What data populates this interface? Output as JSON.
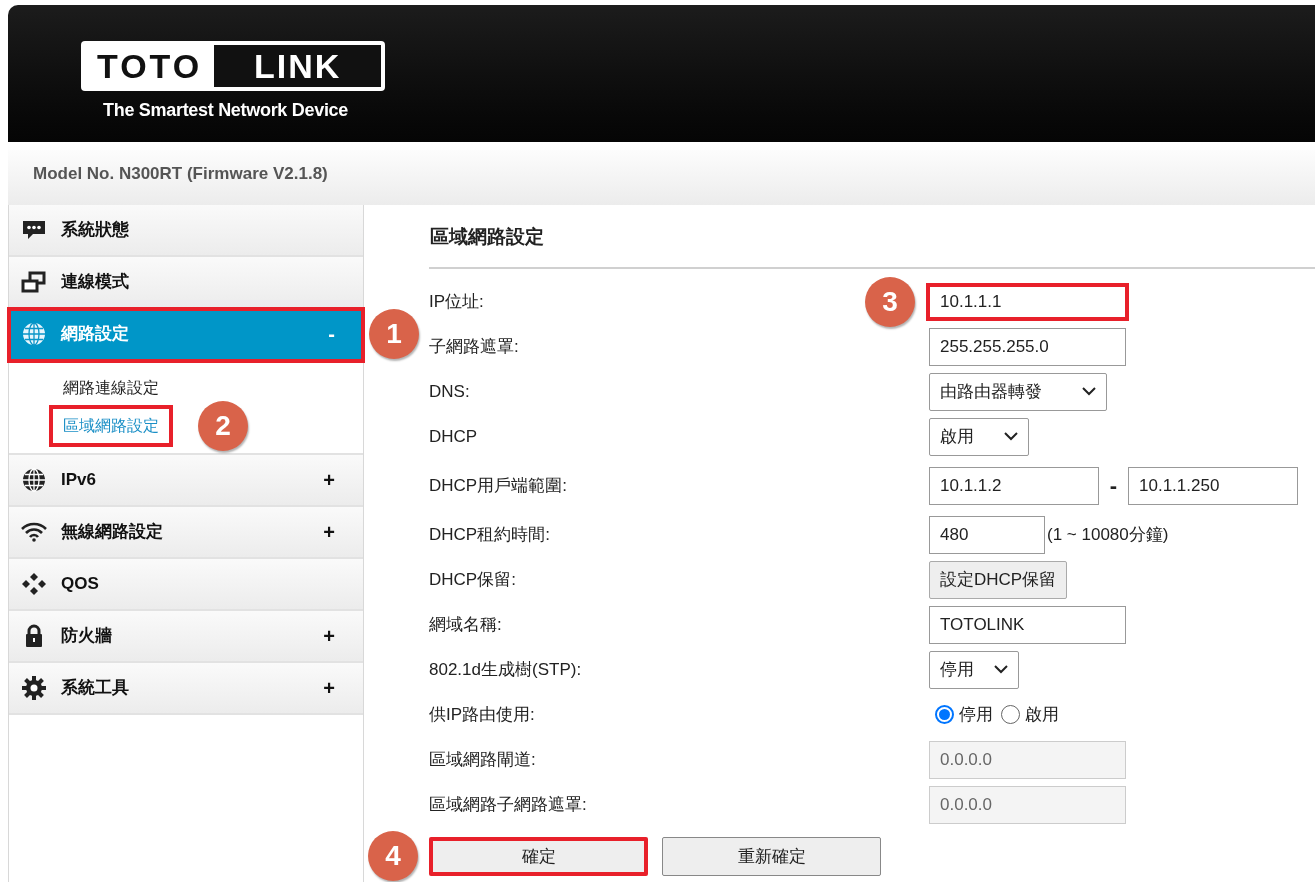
{
  "header": {
    "logo_left": "TOTO",
    "logo_right": "LINK",
    "tagline": "The Smartest Network Device"
  },
  "model_line": "Model No. N300RT (Firmware V2.1.8)",
  "sidebar": {
    "items": [
      {
        "label": "系統狀態",
        "selected": false
      },
      {
        "label": "連線模式",
        "selected": false
      },
      {
        "label": "網路設定",
        "selected": true,
        "toggle": "-",
        "expanded": true,
        "callout": "1",
        "children": [
          {
            "label": "網路連線設定",
            "selected": false
          },
          {
            "label": "區域網路設定",
            "selected": true,
            "callout": "2"
          }
        ]
      },
      {
        "label": "IPv6",
        "selected": false,
        "toggle": "+"
      },
      {
        "label": "無線網路設定",
        "selected": false,
        "toggle": "+"
      },
      {
        "label": "QOS",
        "selected": false
      },
      {
        "label": "防火牆",
        "selected": false,
        "toggle": "+"
      },
      {
        "label": "系統工具",
        "selected": false,
        "toggle": "+"
      }
    ]
  },
  "form": {
    "title": "區域網路設定",
    "rows": [
      {
        "kind": "text",
        "label": "IP位址:",
        "value": "10.1.1.1",
        "callout": "3"
      },
      {
        "kind": "text",
        "label": "子網路遮罩:",
        "value": "255.255.255.0"
      },
      {
        "kind": "select",
        "label": "DNS:",
        "value": "由路由器轉發"
      },
      {
        "kind": "select",
        "label": "DHCP",
        "value": "啟用"
      },
      {
        "kind": "range",
        "label": "DHCP用戶端範圍:",
        "from": "10.1.1.2",
        "separator": "-",
        "to": "10.1.1.250"
      },
      {
        "kind": "note",
        "label": "DHCP租約時間:",
        "value": "480",
        "note": "(1 ~ 10080分鐘)"
      },
      {
        "kind": "button",
        "label": "DHCP保留:",
        "button": "設定DHCP保留"
      },
      {
        "kind": "text",
        "label": "網域名稱:",
        "value": "TOTOLINK"
      },
      {
        "kind": "select",
        "label": "802.1d生成樹(STP):",
        "value": "停用"
      },
      {
        "kind": "radio",
        "label": "供IP路由使用:",
        "options": [
          {
            "label": "停用",
            "selected": true
          },
          {
            "label": "啟用",
            "selected": false
          }
        ]
      },
      {
        "kind": "text",
        "label": "區域網路閘道:",
        "value": "0.0.0.0",
        "disabled": true
      },
      {
        "kind": "text",
        "label": "區域網路子網路遮罩:",
        "value": "0.0.0.0",
        "disabled": true
      }
    ],
    "buttons": [
      {
        "label": "確定",
        "callout": "4"
      },
      {
        "label": "重新確定"
      }
    ]
  }
}
